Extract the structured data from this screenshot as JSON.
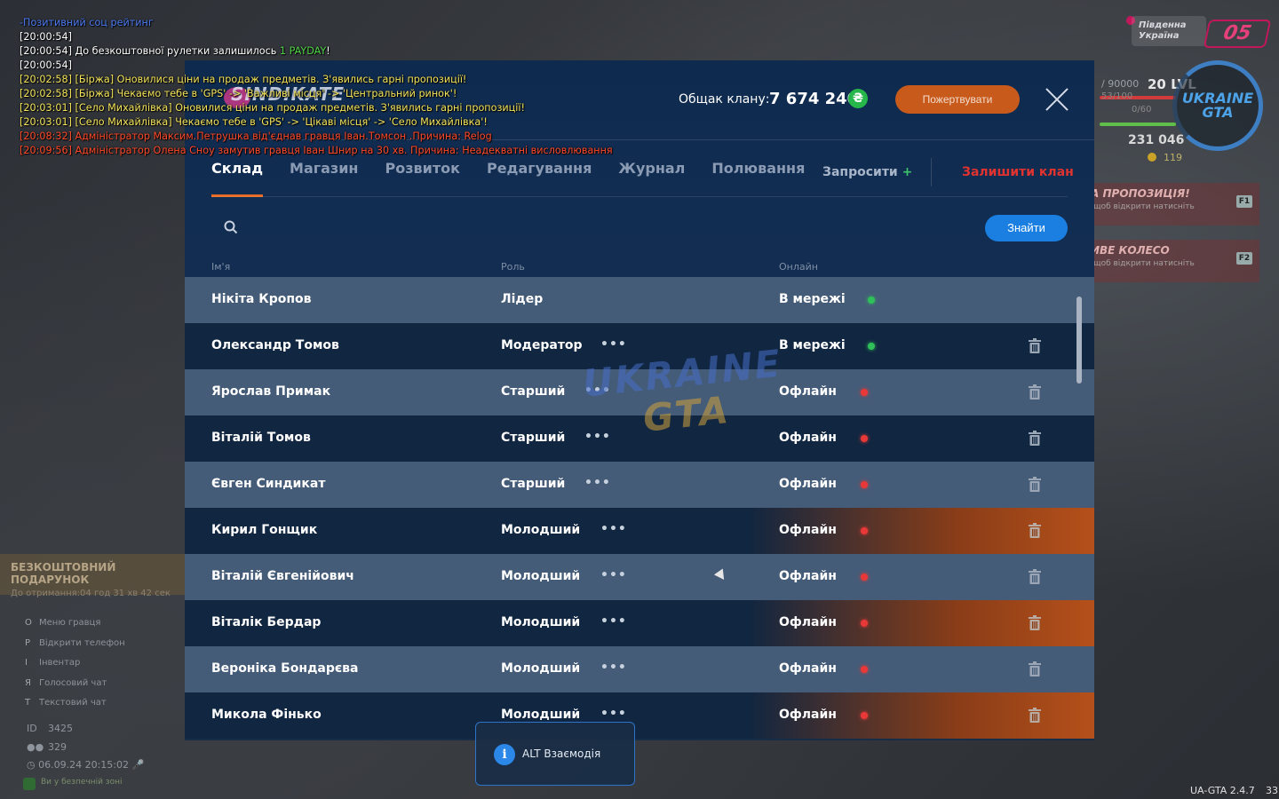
{
  "chat": [
    {
      "text": "-Позитивний соц рейтинг",
      "color": "#4e7cf5"
    },
    {
      "text": "[20:00:54]",
      "color": "#ffffff"
    },
    {
      "text": "[20:00:54] До безкоштовної рулетки залишилось ",
      "color": "#ffffff",
      "extra": "1 PAYDAY",
      "after": "!"
    },
    {
      "text": "[20:00:54]",
      "color": "#ffffff"
    },
    {
      "text": "[20:02:58] [Біржа] Оновилися ціни на продаж предметів. З'явились гарні пропозиції!",
      "color": "#f3e35a"
    },
    {
      "text": "[20:02:58] [Біржа] Чекаємо тебе в 'GPS' -> 'Важливі місця' -> 'Центральний ринок'!",
      "color": "#f3e35a"
    },
    {
      "text": "[20:03:01] [Село Михайлівка] Оновилися ціни на продаж предметів. З'явились гарні пропозиції!",
      "color": "#f3e35a"
    },
    {
      "text": "[20:03:01] [Село Михайлівка] Чекаємо тебе в 'GPS' -> 'Цікаві місця' -> 'Село Михайлівка'!",
      "color": "#f3e35a"
    },
    {
      "text": "[20:08:32] Адміністратор Максим.Петрушка від'єднав гравця Іван.Томсон .Причина: Relog",
      "color": "#ff4a2a"
    },
    {
      "text": "[20:09:56] Адміністратор Олена Сноу замутив гравця Іван Шнир на 30 хв. Причина: Неадекватні висловлювання",
      "color": "#ff4a2a"
    }
  ],
  "panel": {
    "logo_text": "SINDIKATE",
    "balance_label": "Общак клану:",
    "balance_value": "7 674 240",
    "currency_symbol": "₴",
    "donate_label": "Пожертвувати",
    "tabs": [
      "Склад",
      "Магазин",
      "Розвиток",
      "Редагування",
      "Журнал",
      "Полювання"
    ],
    "invite_label": "Запросити",
    "leave_label": "Залишити клан",
    "search_placeholder": "",
    "find_label": "Знайти",
    "columns": {
      "name": "Ім'я",
      "role": "Роль",
      "online": "Онлайн"
    }
  },
  "members": [
    {
      "name": "Нікіта Кропов",
      "role": "Лідер",
      "status": "В мережі",
      "online": true
    },
    {
      "name": "Олександр Томов",
      "role": "Модератор",
      "status": "В мережі",
      "online": true
    },
    {
      "name": "Ярослав Примак",
      "role": "Старший",
      "status": "Офлайн",
      "online": false
    },
    {
      "name": "Віталій Томов",
      "role": "Старший",
      "status": "Офлайн",
      "online": false
    },
    {
      "name": "Євген Синдикат",
      "role": "Старший",
      "status": "Офлайн",
      "online": false
    },
    {
      "name": "Кирил Гонщик",
      "role": "Молодший",
      "status": "Офлайн",
      "online": false
    },
    {
      "name": "Віталій Євгенійович",
      "role": "Молодший",
      "status": "Офлайн",
      "online": false
    },
    {
      "name": "Віталік Бердар",
      "role": "Молодший",
      "status": "Офлайн",
      "online": false
    },
    {
      "name": "Вероніка Бондарєва",
      "role": "Молодший",
      "status": "Офлайн",
      "online": false
    },
    {
      "name": "Микола Фінько",
      "role": "Молодший",
      "status": "Офлайн",
      "online": false
    }
  ],
  "hud_right": {
    "region": "Південна Україна",
    "server": "05",
    "level_text": "/ 90000",
    "level": "20 LVL",
    "sub1": "53/100",
    "sub2": "0/60",
    "money": "231 046",
    "coins": "119",
    "logo": "UKRAINE GTA",
    "promo1_title": "НА ПРОПОЗИЦІЯ!",
    "promo1_sub": "го щоб відкрити натисніть",
    "promo1_key": "F1",
    "promo2_title": "ЛИВЕ КОЛЕСО",
    "promo2_sub": "го щоб відкрити натисніть",
    "promo2_key": "F2",
    "version": "UA-GTA 2.4.7",
    "fps": "33"
  },
  "hud_left": {
    "gift_title": "БЕЗКОШТОВНИЙ ПОДАРУНОК",
    "gift_sub": "До отримання:",
    "gift_time": "04 год 31 хв 42 сек",
    "hints": [
      {
        "key": "O",
        "label": "Меню гравця"
      },
      {
        "key": "P",
        "label": "Відкрити телефон"
      },
      {
        "key": "I",
        "label": "Інвентар"
      },
      {
        "key": "Я",
        "label": "Голосовий чат"
      },
      {
        "key": "T",
        "label": "Текстовий чат"
      }
    ],
    "id_label": "ID",
    "id_value": "3425",
    "online_value": "329",
    "datetime": "06.09.24 20:15:02",
    "safe_zone": "Ви у безпечній зоні"
  },
  "tooltip": {
    "icon": "i",
    "text": "ALT Взаємодія"
  },
  "watermark": {
    "line1": "UKRAINE",
    "line2": "GTA"
  },
  "colors": {
    "accent_orange": "#e86a24",
    "online": "#2fc05a",
    "offline": "#e83838",
    "find_button": "#1a7fe0",
    "leave": "#e0332f"
  }
}
